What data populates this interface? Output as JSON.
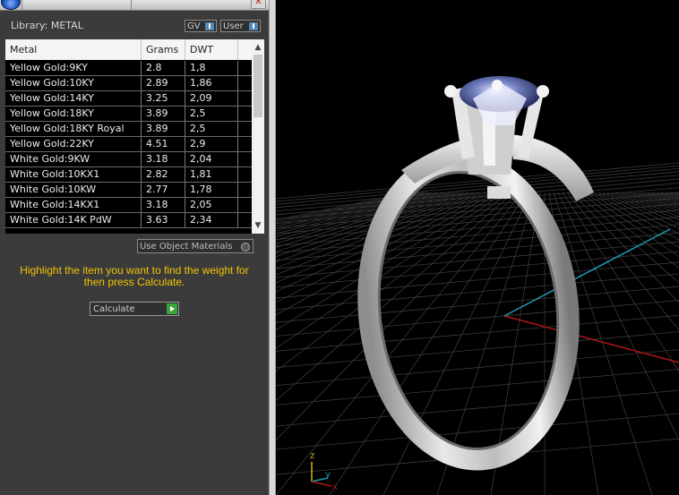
{
  "panel": {
    "library_label": "Library: METAL",
    "gv_label": "GV",
    "user_label": "User",
    "table": {
      "headers": [
        "Metal",
        "Grams",
        "DWT"
      ],
      "rows": [
        {
          "metal": "Yellow Gold:9KY",
          "grams": "2.8",
          "dwt": "1,8"
        },
        {
          "metal": "Yellow Gold:10KY",
          "grams": "2.89",
          "dwt": "1,86"
        },
        {
          "metal": "Yellow Gold:14KY",
          "grams": "3.25",
          "dwt": "2,09"
        },
        {
          "metal": "Yellow Gold:18KY",
          "grams": "3.89",
          "dwt": "2,5"
        },
        {
          "metal": "Yellow Gold:18KY Royal",
          "grams": "3.89",
          "dwt": "2,5"
        },
        {
          "metal": "Yellow Gold:22KY",
          "grams": "4.51",
          "dwt": "2,9"
        },
        {
          "metal": "White Gold:9KW",
          "grams": "3.18",
          "dwt": "2,04"
        },
        {
          "metal": "White Gold:10KX1",
          "grams": "2.82",
          "dwt": "1,81"
        },
        {
          "metal": "White Gold:10KW",
          "grams": "2.77",
          "dwt": "1,78"
        },
        {
          "metal": "White Gold:14KX1",
          "grams": "3.18",
          "dwt": "2,05"
        },
        {
          "metal": "White Gold:14K PdW",
          "grams": "3.63",
          "dwt": "2,34"
        }
      ]
    },
    "use_object_materials_label": "Use Object Materials",
    "instructions": "Highlight the item you want to find the weight for then press Calculate.",
    "calculate_label": "Calculate"
  },
  "viewport": {
    "axis_labels": {
      "z": "z",
      "y": "y",
      "x": "x"
    },
    "colors": {
      "x_axis": "#b01515",
      "y_axis": "#1e9ab0",
      "grid": "#3a3a3a",
      "background": "#000000",
      "instructions_text": "#f2c400"
    }
  }
}
